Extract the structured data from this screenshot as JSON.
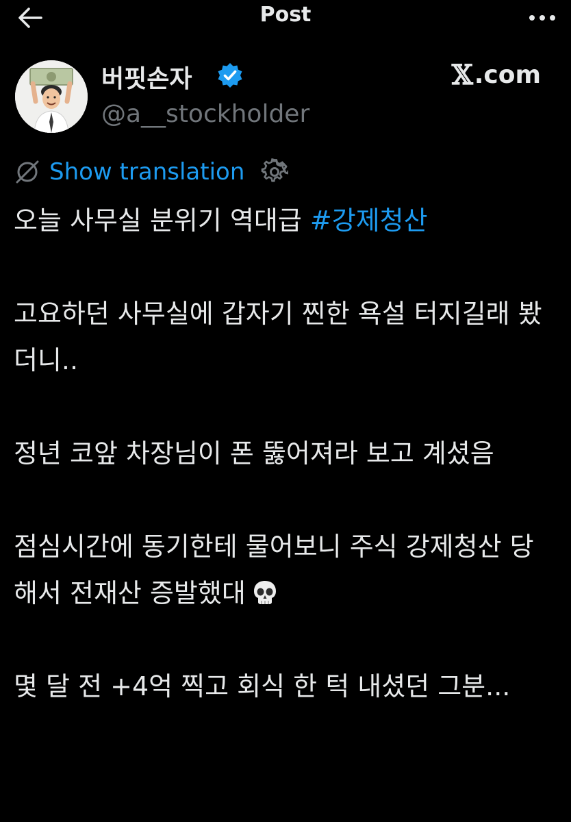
{
  "header": {
    "title": "Post",
    "back_icon": "arrow-left-icon",
    "more_icon": "more-horizontal-icon"
  },
  "author": {
    "display_name": "버핏손자",
    "handle": "@a__stockholder",
    "verified_icon": "verified-badge-icon",
    "verified_color": "#1d9bf0"
  },
  "watermark": {
    "x": "𝕏",
    "domain": ".com"
  },
  "translation": {
    "label": "Show translation",
    "icon": "translate-off-icon",
    "settings_icon": "gear-icon"
  },
  "post": {
    "line1_text": "오늘 사무실 분위기 역대급 ",
    "hashtag": "#강제청산",
    "para2": "고요하던 사무실에 갑자기 찐한 욕설 터지길래 봤더니..",
    "para3": "정년 코앞 차장님이 폰 뚫어져라 보고 계셨음",
    "para4": "점심시간에 동기한테 물어보니 주식 강제청산 당해서 전재산 증발했대",
    "para4_emoji": "skull-emoji",
    "para5": "몇 달 전 +4억 찍고 회식 한 턱 내셨던 그분..."
  },
  "colors": {
    "background": "#000000",
    "text": "#e7e9ea",
    "secondary": "#71767b",
    "accent": "#1d9bf0"
  }
}
